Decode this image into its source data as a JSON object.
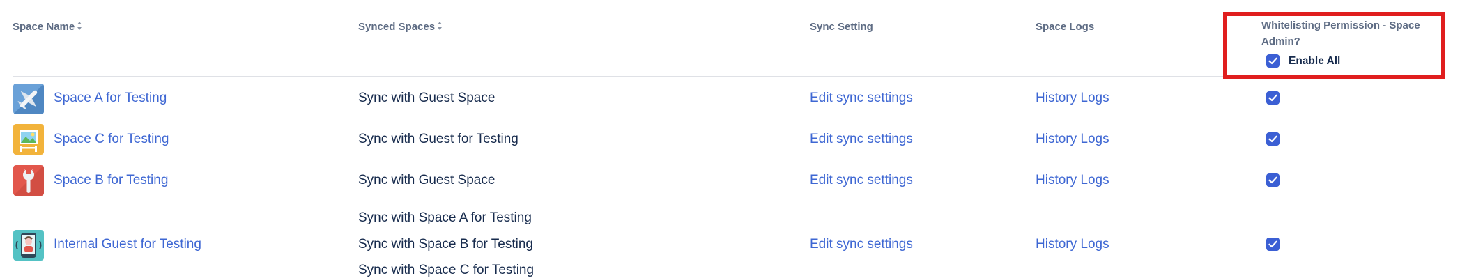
{
  "columns": {
    "space_name": "Space Name",
    "synced_spaces": "Synced Spaces",
    "sync_setting": "Sync Setting",
    "space_logs": "Space Logs",
    "whitelisting": "Whitelisting Permission - Space Admin?"
  },
  "enable_all": {
    "label": "Enable All",
    "checked": true
  },
  "rows": [
    {
      "name": "Space A for Testing",
      "synced": [
        "Sync with Guest Space"
      ],
      "edit": "Edit sync settings",
      "logs": "History Logs",
      "checked": true,
      "icon": "airplane-icon"
    },
    {
      "name": "Space C for Testing",
      "synced": [
        "Sync with Guest for Testing"
      ],
      "edit": "Edit sync settings",
      "logs": "History Logs",
      "checked": true,
      "icon": "easel-picture-icon"
    },
    {
      "name": "Space B for Testing",
      "synced": [
        "Sync with Guest Space"
      ],
      "edit": "Edit sync settings",
      "logs": "History Logs",
      "checked": true,
      "icon": "wrench-icon"
    },
    {
      "name": "Internal Guest for Testing",
      "synced": [
        "Sync with Space A for Testing",
        "Sync with Space B for Testing",
        "Sync with Space C for Testing"
      ],
      "edit": "Edit sync settings",
      "logs": "History Logs",
      "checked": true,
      "icon": "phone-person-icon"
    }
  ],
  "colors": {
    "link": "#3e67d3",
    "checkbox": "#3b5fd4",
    "highlight": "#e01e1e",
    "header_text": "#5e6c84"
  }
}
